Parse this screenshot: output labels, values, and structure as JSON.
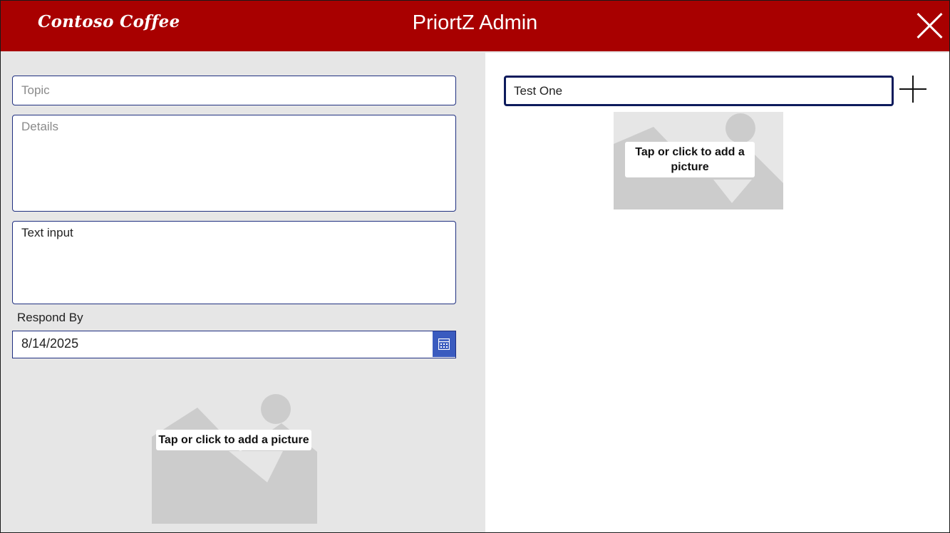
{
  "header": {
    "brand": "Contoso Coffee",
    "title": "PriortZ Admin",
    "close_icon": "close-icon",
    "background_color": "#a80000"
  },
  "form": {
    "topic_placeholder": "Topic",
    "details_placeholder": "Details",
    "text_input_value": "Text input",
    "respond_by_label": "Respond By",
    "respond_by_value": "8/14/2025",
    "calendar_icon": "calendar-icon",
    "picture_label": "Tap or click to add a picture",
    "border_color": "#1f2f80"
  },
  "right": {
    "search_value": "Test One",
    "add_icon": "plus-icon",
    "picture_label": "Tap or click to add a picture"
  }
}
